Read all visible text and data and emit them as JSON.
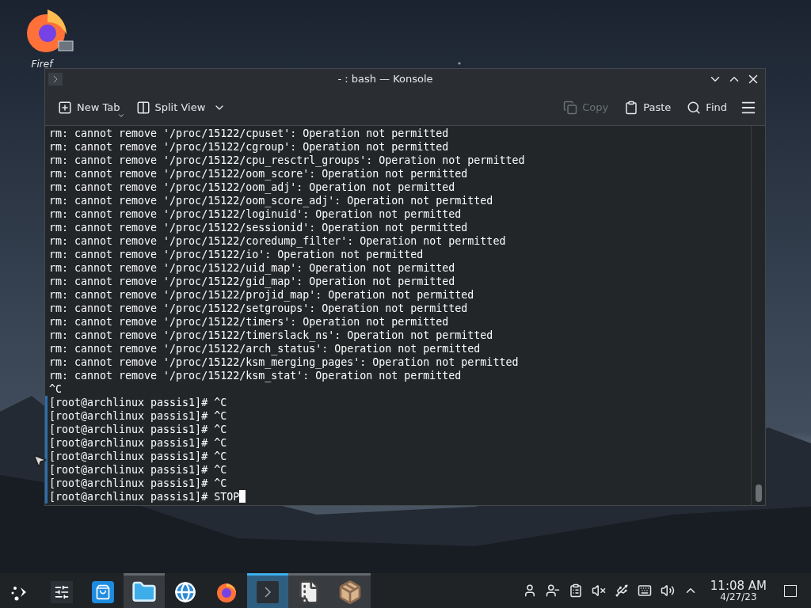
{
  "desktop_icons": [
    {
      "label": "Firef"
    }
  ],
  "window": {
    "title": "- : bash — Konsole",
    "toolbar": [
      {
        "kind": "new-tab",
        "label": "New Tab",
        "disabled": false
      },
      {
        "kind": "split-view",
        "label": "Split View",
        "disabled": false
      },
      {
        "kind": "copy",
        "label": "Copy",
        "disabled": true
      },
      {
        "kind": "paste",
        "label": "Paste",
        "disabled": false
      },
      {
        "kind": "find",
        "label": "Find",
        "disabled": false
      }
    ],
    "terminal_lines": [
      {
        "text": "rm: cannot remove '/proc/15122/cpuset': Operation not permitted",
        "marked": false
      },
      {
        "text": "rm: cannot remove '/proc/15122/cgroup': Operation not permitted",
        "marked": false
      },
      {
        "text": "rm: cannot remove '/proc/15122/cpu_resctrl_groups': Operation not permitted",
        "marked": false
      },
      {
        "text": "rm: cannot remove '/proc/15122/oom_score': Operation not permitted",
        "marked": false
      },
      {
        "text": "rm: cannot remove '/proc/15122/oom_adj': Operation not permitted",
        "marked": false
      },
      {
        "text": "rm: cannot remove '/proc/15122/oom_score_adj': Operation not permitted",
        "marked": false
      },
      {
        "text": "rm: cannot remove '/proc/15122/loginuid': Operation not permitted",
        "marked": false
      },
      {
        "text": "rm: cannot remove '/proc/15122/sessionid': Operation not permitted",
        "marked": false
      },
      {
        "text": "rm: cannot remove '/proc/15122/coredump_filter': Operation not permitted",
        "marked": false
      },
      {
        "text": "rm: cannot remove '/proc/15122/io': Operation not permitted",
        "marked": false
      },
      {
        "text": "rm: cannot remove '/proc/15122/uid_map': Operation not permitted",
        "marked": false
      },
      {
        "text": "rm: cannot remove '/proc/15122/gid_map': Operation not permitted",
        "marked": false
      },
      {
        "text": "rm: cannot remove '/proc/15122/projid_map': Operation not permitted",
        "marked": false
      },
      {
        "text": "rm: cannot remove '/proc/15122/setgroups': Operation not permitted",
        "marked": false
      },
      {
        "text": "rm: cannot remove '/proc/15122/timers': Operation not permitted",
        "marked": false
      },
      {
        "text": "rm: cannot remove '/proc/15122/timerslack_ns': Operation not permitted",
        "marked": false
      },
      {
        "text": "rm: cannot remove '/proc/15122/arch_status': Operation not permitted",
        "marked": false
      },
      {
        "text": "rm: cannot remove '/proc/15122/ksm_merging_pages': Operation not permitted",
        "marked": false
      },
      {
        "text": "rm: cannot remove '/proc/15122/ksm_stat': Operation not permitted",
        "marked": false
      },
      {
        "text": "^C",
        "marked": false
      },
      {
        "text": "[root@archlinux passis1]# ^C",
        "marked": true
      },
      {
        "text": "[root@archlinux passis1]# ^C",
        "marked": true
      },
      {
        "text": "[root@archlinux passis1]# ^C",
        "marked": true
      },
      {
        "text": "[root@archlinux passis1]# ^C",
        "marked": true
      },
      {
        "text": "[root@archlinux passis1]# ^C",
        "marked": true
      },
      {
        "text": "[root@archlinux passis1]# ^C",
        "marked": true
      },
      {
        "text": "[root@archlinux passis1]# ^C",
        "marked": true
      },
      {
        "text": "[root@archlinux passis1]# STOP",
        "marked": true,
        "cursor": true
      }
    ]
  },
  "taskbar": {
    "tasks": [
      {
        "kind": "launcher",
        "open": false,
        "selected": false
      },
      {
        "kind": "mixer",
        "open": false,
        "selected": false
      },
      {
        "kind": "store",
        "open": false,
        "selected": false
      },
      {
        "kind": "folder",
        "open": true,
        "selected": false
      },
      {
        "kind": "globe",
        "open": false,
        "selected": false
      },
      {
        "kind": "browser",
        "open": false,
        "selected": false
      },
      {
        "kind": "terminal",
        "open": true,
        "selected": true
      },
      {
        "kind": "archive",
        "open": true,
        "selected": false
      },
      {
        "kind": "package",
        "open": true,
        "selected": false
      }
    ],
    "tray": [
      {
        "kind": "user"
      },
      {
        "kind": "user-minus"
      },
      {
        "kind": "clipboard"
      },
      {
        "kind": "muted"
      },
      {
        "kind": "usb"
      },
      {
        "kind": "keyboard"
      },
      {
        "kind": "volume"
      },
      {
        "kind": "expand"
      }
    ],
    "time": "11:08 AM",
    "date": "4/27/23"
  }
}
